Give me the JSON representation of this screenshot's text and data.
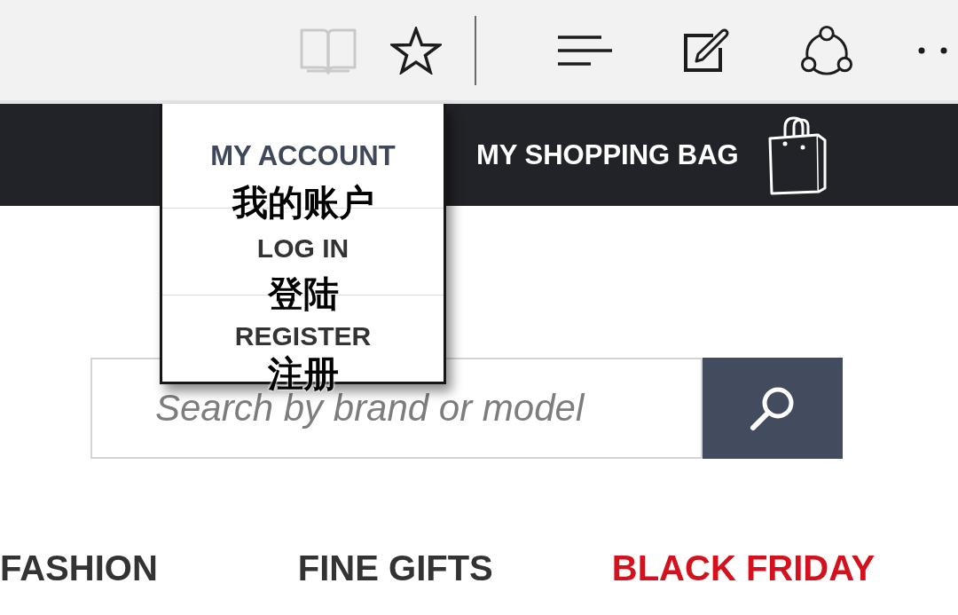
{
  "toolbar": {
    "page_buttons": [
      {
        "kind": "reading_view",
        "disabled": true
      },
      {
        "kind": "favorite",
        "disabled": false
      }
    ],
    "tool_buttons": [
      {
        "kind": "hub"
      },
      {
        "kind": "note"
      },
      {
        "kind": "share"
      },
      {
        "kind": "more"
      }
    ]
  },
  "header": {
    "account_menu": {
      "label": "MY ACCOUNT",
      "note": "我的账户",
      "expanded": true,
      "items": [
        {
          "label": "LOG IN",
          "note": "登陆"
        },
        {
          "label": "REGISTER",
          "note": "注册"
        }
      ]
    },
    "shopping_bag": {
      "label": "MY SHOPPING BAG"
    }
  },
  "search": {
    "placeholder": "Search by brand or model"
  },
  "categories": [
    {
      "label": "FASHION",
      "color": "#333333"
    },
    {
      "label": "FINE GIFTS",
      "color": "#333333"
    },
    {
      "label": "BLACK FRIDAY",
      "color": "#d4121e"
    }
  ]
}
